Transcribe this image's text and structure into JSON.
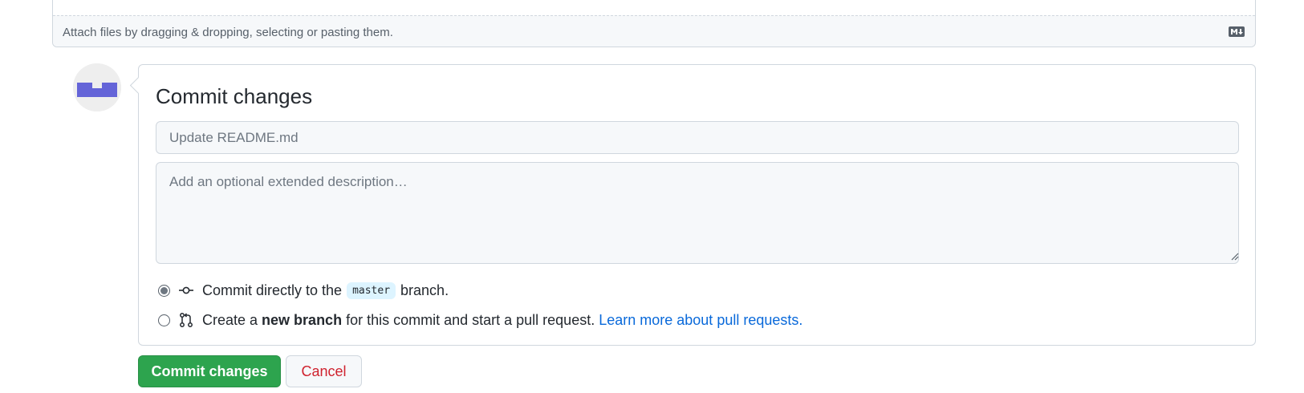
{
  "editor": {
    "attach_text": "Attach files by dragging & dropping, selecting or pasting them."
  },
  "icons": {
    "markdown": "markdown-icon",
    "commit": "git-commit-icon",
    "pull_request": "git-pull-request-icon",
    "resize": "resize-handle-icon"
  },
  "commit_form": {
    "title": "Commit changes",
    "summary_placeholder": "Update README.md",
    "summary_value": "",
    "description_placeholder": "Add an optional extended description…",
    "description_value": "",
    "option_direct": {
      "prefix": "Commit directly to the",
      "branch": "master",
      "suffix": "branch.",
      "selected": true
    },
    "option_new_branch": {
      "prefix": "Create a",
      "bold": "new branch",
      "suffix": "for this commit and start a pull request.",
      "link": "Learn more about pull requests.",
      "selected": false
    }
  },
  "buttons": {
    "commit": "Commit changes",
    "cancel": "Cancel"
  },
  "colors": {
    "primary_button": "#2da44e",
    "cancel_text": "#cf222e",
    "link": "#0969da",
    "avatar_accent": "#6464d8",
    "branch_badge_bg": "#ddf4ff"
  }
}
